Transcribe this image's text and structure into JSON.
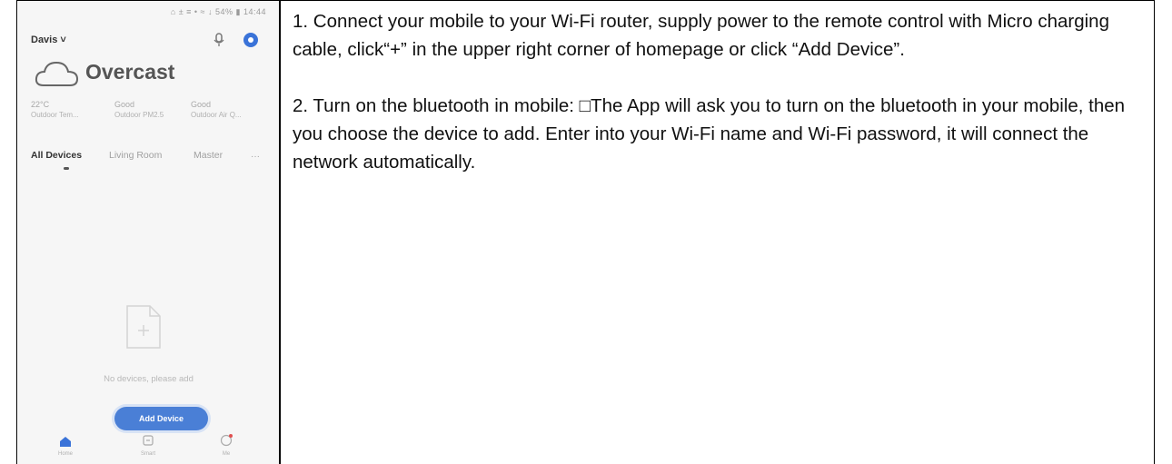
{
  "phone": {
    "status_bar": "⌂ ± ≡ • ≈ ↓ 54% ▮ 14:44",
    "home_name": "Davis ˅",
    "weather": "Overcast",
    "stats": [
      {
        "value": "22°C",
        "label": "Outdoor Tem..."
      },
      {
        "value": "Good",
        "label": "Outdoor PM2.5"
      },
      {
        "value": "Good",
        "label": "Outdoor Air Q..."
      }
    ],
    "tabs": [
      "All Devices",
      "Living Room",
      "Master"
    ],
    "more": "···",
    "empty_text": "No devices, please add",
    "add_button": "Add Device",
    "nav": [
      "Home",
      "Smart",
      "Me"
    ]
  },
  "instructions": {
    "step1": "1. Connect your mobile to your Wi-Fi router, supply power to the remote control with Micro charging cable, click“+” in the upper right corner of homepage or click “Add Device”.",
    "step2": "2. Turn on the bluetooth in mobile: □The App will ask you to turn on the bluetooth in your mobile, then you choose the device to add. Enter into your Wi-Fi name and Wi-Fi password, it will connect the network automatically."
  }
}
